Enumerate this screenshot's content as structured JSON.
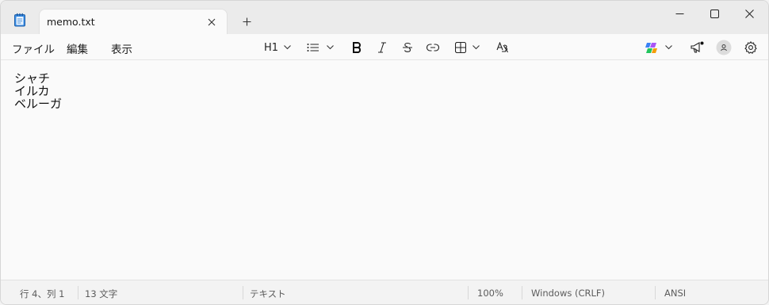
{
  "tab": {
    "title": "memo.txt"
  },
  "menu": {
    "file": "ファイル",
    "edit": "編集",
    "view": "表示"
  },
  "toolbar": {
    "heading": "H1"
  },
  "editor": {
    "lines": [
      "シャチ",
      "イルカ",
      "ベルーガ"
    ]
  },
  "status": {
    "position": "行 4、列 1",
    "char_count": "13 文字",
    "format": "テキスト",
    "zoom": "100%",
    "line_ending": "Windows (CRLF)",
    "encoding": "ANSI"
  },
  "colors": {
    "titlebar_bg": "#ebebeb",
    "editor_bg": "#fafafa",
    "statusbar_bg": "#f3f3f3",
    "notepad_icon_blue": "#1f6fc9",
    "copilot_gradient": [
      "#3b82f6",
      "#a855f7",
      "#f59e0b",
      "#22c55e"
    ]
  },
  "icons": {
    "app": "notepad-icon",
    "tab_close": "close-icon",
    "new_tab": "plus-icon",
    "minimize": "minimize-icon",
    "maximize": "maximize-icon",
    "close": "close-icon",
    "heading_dropdown": "chevron-down-icon",
    "list": "bulleted-list-icon",
    "bold": "bold-icon",
    "italic": "italic-icon",
    "strikethrough": "strikethrough-icon",
    "link": "link-icon",
    "table": "table-icon",
    "spellcheck": "spellcheck-icon",
    "copilot": "copilot-icon",
    "whats_new": "megaphone-icon",
    "account": "account-icon",
    "settings": "gear-icon"
  }
}
